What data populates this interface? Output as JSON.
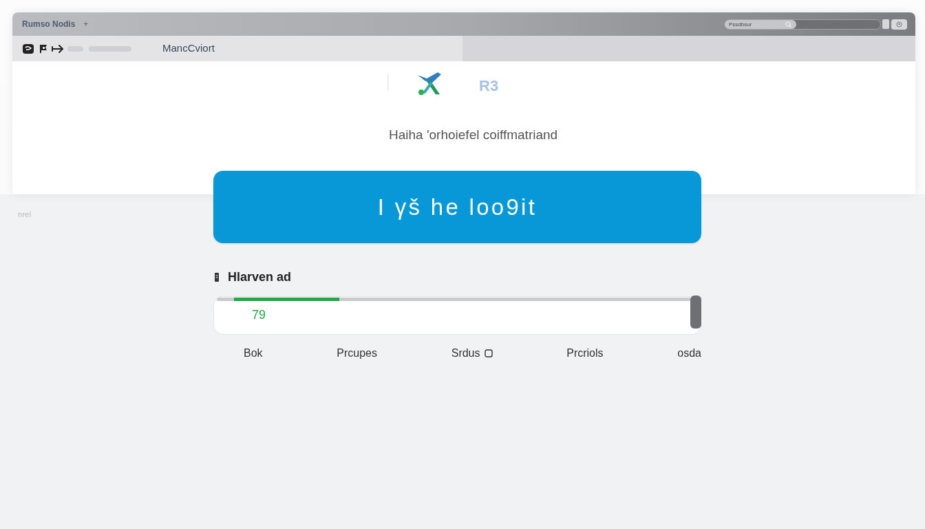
{
  "window": {
    "title": "Rumso Nodis",
    "new_tab_button": "+",
    "search": {
      "placeholder": "Pssdbsur"
    }
  },
  "toolbar": {
    "location": "MancCviort"
  },
  "header": {
    "badge": "R3",
    "subtitle": "Haiha 'orhoiefel coiffmatriand"
  },
  "primary_button": "I γš he loo9it",
  "side_note": "nrel",
  "progress": {
    "label": "Hlarven ad",
    "level": 0.23,
    "reading": "79"
  },
  "steps": [
    {
      "label": "Bok",
      "kind": "text"
    },
    {
      "label": "Prcupes",
      "kind": "text"
    },
    {
      "label": "Srdus",
      "kind": "with-icon"
    },
    {
      "label": "Prcriols",
      "kind": "text"
    },
    {
      "label": "osda",
      "kind": "text"
    }
  ]
}
